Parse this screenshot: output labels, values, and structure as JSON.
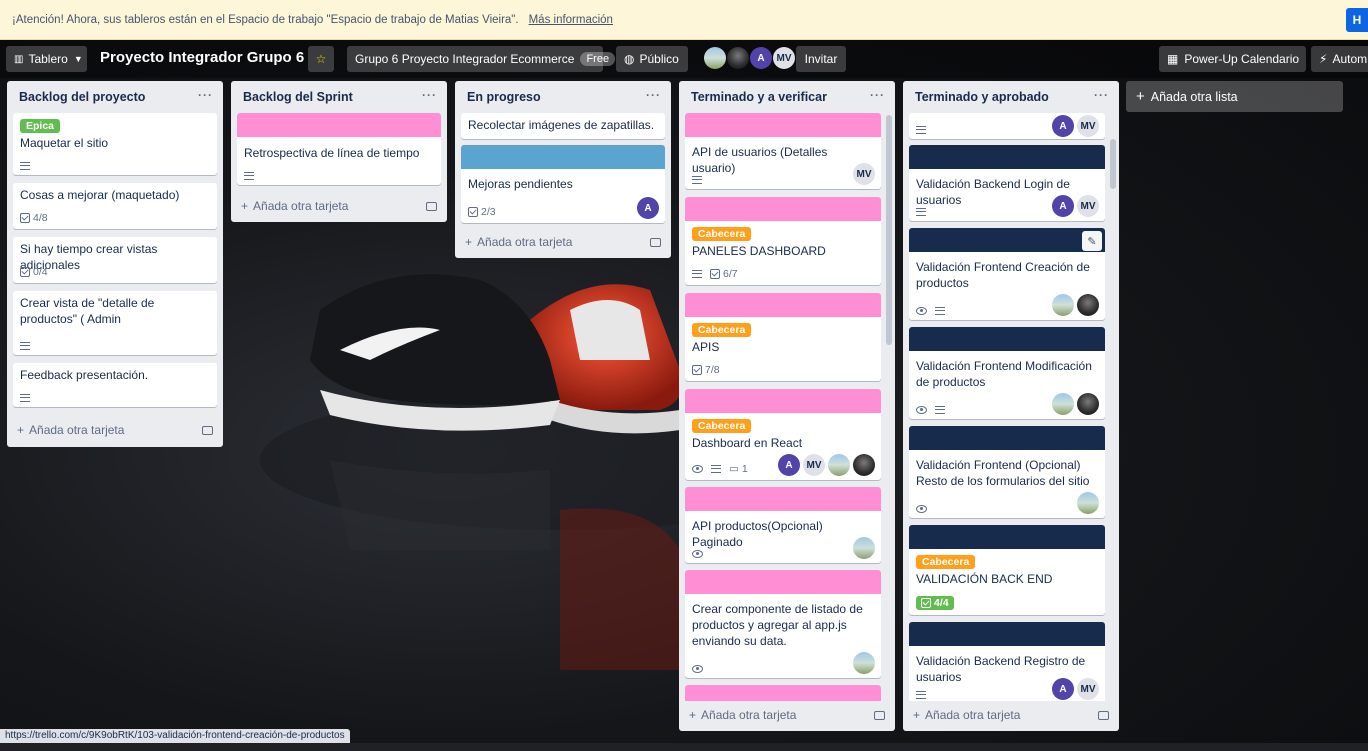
{
  "banner": {
    "text": "¡Atención! Ahora, sus tableros están en el Espacio de trabajo \"Espacio de trabajo de Matias Vieira\".",
    "more": "Más información",
    "button": "H"
  },
  "header": {
    "view": "Tablero",
    "board_title": "Proyecto Integrador Grupo 6",
    "workspace": "Grupo 6 Proyecto Integrador Ecommerce",
    "workspace_plan": "Free",
    "visibility": "Público",
    "invite": "Invitar",
    "powerup": "Power-Up Calendario",
    "automation": "Autom",
    "members": [
      "",
      "",
      "A",
      "MV"
    ]
  },
  "add_list": "Añada otra lista",
  "lists": [
    {
      "title": "Backlog del proyecto",
      "add": "Añada otra tarjeta",
      "cards": [
        {
          "label": "Epica",
          "title": "Maquetar el sitio"
        },
        {
          "title": "Cosas a mejorar (maquetado)",
          "checklist": "4/8"
        },
        {
          "title": "Si hay tiempo crear vistas adicionales",
          "checklist": "0/4"
        },
        {
          "title": "Crear vista de \"detalle de productos\" ( Admin"
        },
        {
          "title": "Feedback presentación."
        }
      ]
    },
    {
      "title": "Backlog del Sprint",
      "add": "Añada otra tarjeta",
      "cards": [
        {
          "title": "Retrospectiva de línea de tiempo"
        }
      ]
    },
    {
      "title": "En progreso",
      "add": "Añada otra tarjeta",
      "cards": [
        {
          "title": "Recolectar imágenes de zapatillas."
        },
        {
          "title": "Mejoras pendientes",
          "checklist": "2/3",
          "member": "A"
        }
      ]
    },
    {
      "title": "Terminado y a verificar",
      "add": "Añada otra tarjeta",
      "cards": [
        {
          "title": "API de usuarios (Detalles usuario)",
          "member": "MV"
        },
        {
          "label": "Cabecera",
          "title": "PANELES DASHBOARD",
          "checklist": "6/7"
        },
        {
          "label": "Cabecera",
          "title": "APIS",
          "checklist": "7/8"
        },
        {
          "label": "Cabecera",
          "title": "Dashboard en React",
          "comments": "1",
          "members": [
            "A",
            "MV"
          ]
        },
        {
          "title": "API productos(Opcional) Paginado"
        },
        {
          "title": "Crear componente de listado de productos y agregar al app.js enviando su data."
        }
      ]
    },
    {
      "title": "Terminado y aprobado",
      "add": "Añada otra tarjeta",
      "cards": [
        {
          "members": [
            "A",
            "MV"
          ]
        },
        {
          "title": "Validación Backend Login de usuarios",
          "members": [
            "A",
            "MV"
          ]
        },
        {
          "title": "Validación Frontend Creación de productos"
        },
        {
          "title": "Validación Frontend Modificación de productos"
        },
        {
          "title": "Validación Frontend (Opcional) Resto de los formularios del sitio"
        },
        {
          "label": "Cabecera",
          "title": "VALIDACIÓN BACK END",
          "checklist": "4/4"
        },
        {
          "title": "Validación Backend Registro de usuarios",
          "members": [
            "A",
            "MV"
          ]
        }
      ]
    }
  ],
  "statusbar": "https://trello.com/c/9K9obRtK/103-validación-frontend-creación-de-productos",
  "colors": {
    "pink": "#ff8ed4",
    "blue": "#5ba4cf",
    "navy": "#172b4d",
    "green": "#61bd4f",
    "orange": "#ff9f1a"
  }
}
